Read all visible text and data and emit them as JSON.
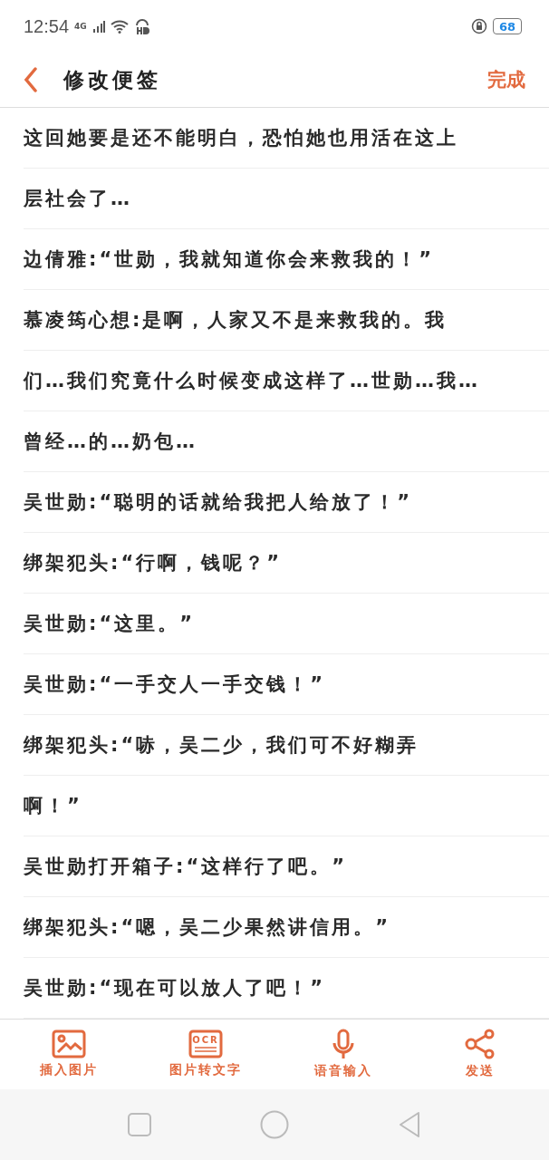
{
  "status_bar": {
    "time": "12:54",
    "network": "4G",
    "battery": "68"
  },
  "header": {
    "title": "修改便签",
    "done": "完成"
  },
  "lines": [
    "这回她要是还不能明白，恐怕她也用活在这上",
    "层社会了…",
    "边倩雅:“世勋，我就知道你会来救我的！”",
    "慕凌筠心想:是啊，人家又不是来救我的。我",
    "们…我们究竟什么时候变成这样了…世勋…我…",
    "曾经…的…奶包…",
    "吴世勋:“聪明的话就给我把人给放了！”",
    "绑架犯头:“行啊，钱呢？”",
    "吴世勋:“这里。”",
    "吴世勋:“一手交人一手交钱！”",
    "绑架犯头:“哧，吴二少，我们可不好糊弄",
    "啊！”",
    "吴世勋打开箱子:“这样行了吧。”",
    "绑架犯头:“嗯，吴二少果然讲信用。”",
    "吴世勋:“现在可以放人了吧！”"
  ],
  "toolbar": [
    {
      "kind": "image",
      "label": "插入图片"
    },
    {
      "kind": "ocr",
      "label": "图片转文字",
      "icon_text": "OCR"
    },
    {
      "kind": "mic",
      "label": "语音输入"
    },
    {
      "kind": "share",
      "label": "发送"
    }
  ]
}
